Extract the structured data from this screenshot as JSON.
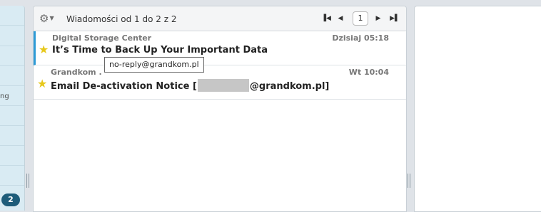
{
  "sidebar": {
    "partial_text": "ng",
    "badge_count": "2"
  },
  "toolbar": {
    "settings_icon": "gear-icon",
    "message_count_text": "Wiadomości od 1 do 2 z 2",
    "page_number": "1",
    "first_icon": "first-page-icon",
    "prev_icon": "prev-page-icon",
    "next_icon": "next-page-icon",
    "last_icon": "last-page-icon"
  },
  "messages": [
    {
      "sender": "Digital Storage Center",
      "date": "Dzisiaj 05:18",
      "subject": "It’s Time to Back Up Your Important Data",
      "flagged": true
    },
    {
      "sender": "Grandkom .",
      "date": "Wt 10:04",
      "subject_prefix": "Email De-activation Notice [",
      "subject_suffix": "@grandkom.pl]",
      "flagged": true
    }
  ],
  "tooltip": {
    "text": "no-reply@grandkom.pl"
  },
  "colors": {
    "selected_accent": "#2d9bd6",
    "star": "#e7c81a",
    "badge": "#1d5c7a"
  }
}
